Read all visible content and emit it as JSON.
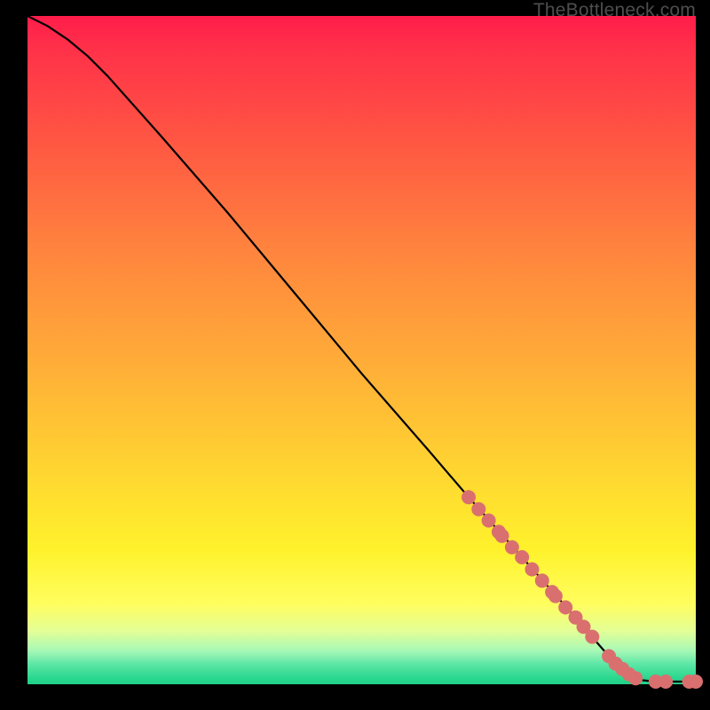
{
  "watermark": "TheBottleneck.com",
  "colors": {
    "dot": "#d9706f",
    "curve": "#000000"
  },
  "chart_data": {
    "type": "line",
    "title": "",
    "xlabel": "",
    "ylabel": "",
    "xlim": [
      0,
      100
    ],
    "ylim": [
      0,
      100
    ],
    "grid": false,
    "curve": [
      {
        "x": 0,
        "y": 100
      },
      {
        "x": 3,
        "y": 98.5
      },
      {
        "x": 6,
        "y": 96.5
      },
      {
        "x": 9,
        "y": 94.0
      },
      {
        "x": 12,
        "y": 91.0
      },
      {
        "x": 20,
        "y": 82.0
      },
      {
        "x": 30,
        "y": 70.5
      },
      {
        "x": 40,
        "y": 58.5
      },
      {
        "x": 50,
        "y": 46.5
      },
      {
        "x": 60,
        "y": 35.0
      },
      {
        "x": 66,
        "y": 28.0
      },
      {
        "x": 70,
        "y": 23.5
      },
      {
        "x": 74,
        "y": 19.0
      },
      {
        "x": 78,
        "y": 14.5
      },
      {
        "x": 82,
        "y": 10.0
      },
      {
        "x": 85,
        "y": 6.5
      },
      {
        "x": 87,
        "y": 4.2
      },
      {
        "x": 89,
        "y": 2.3
      },
      {
        "x": 90.5,
        "y": 1.2
      },
      {
        "x": 92,
        "y": 0.6
      },
      {
        "x": 94,
        "y": 0.4
      },
      {
        "x": 96,
        "y": 0.4
      },
      {
        "x": 98,
        "y": 0.4
      },
      {
        "x": 100,
        "y": 0.4
      }
    ],
    "dots": [
      {
        "x": 66.0,
        "y": 28.0
      },
      {
        "x": 67.5,
        "y": 26.2
      },
      {
        "x": 69.0,
        "y": 24.5
      },
      {
        "x": 70.5,
        "y": 22.8
      },
      {
        "x": 71.0,
        "y": 22.2
      },
      {
        "x": 72.5,
        "y": 20.5
      },
      {
        "x": 74.0,
        "y": 19.0
      },
      {
        "x": 75.5,
        "y": 17.2
      },
      {
        "x": 77.0,
        "y": 15.5
      },
      {
        "x": 78.5,
        "y": 13.8
      },
      {
        "x": 79.0,
        "y": 13.2
      },
      {
        "x": 80.5,
        "y": 11.5
      },
      {
        "x": 82.0,
        "y": 10.0
      },
      {
        "x": 83.2,
        "y": 8.6
      },
      {
        "x": 84.5,
        "y": 7.1
      },
      {
        "x": 87.0,
        "y": 4.2
      },
      {
        "x": 88.0,
        "y": 3.1
      },
      {
        "x": 89.0,
        "y": 2.3
      },
      {
        "x": 90.0,
        "y": 1.5
      },
      {
        "x": 91.0,
        "y": 0.9
      },
      {
        "x": 94.0,
        "y": 0.4
      },
      {
        "x": 95.5,
        "y": 0.4
      },
      {
        "x": 99.0,
        "y": 0.4
      },
      {
        "x": 100.0,
        "y": 0.4
      }
    ]
  }
}
